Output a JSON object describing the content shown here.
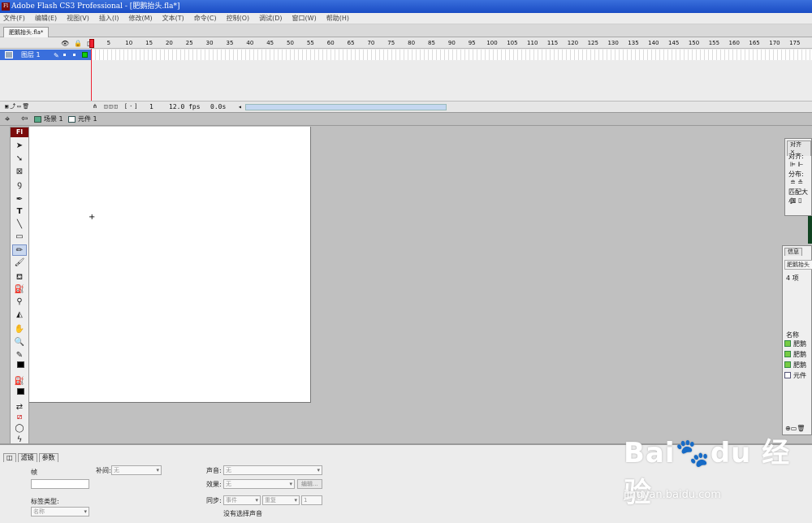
{
  "window": {
    "title": "Adobe Flash CS3 Professional - [肥鹅抬头.fla*]",
    "app_icon": "Fl"
  },
  "menu": [
    "文件(F)",
    "编辑(E)",
    "视图(V)",
    "插入(I)",
    "修改(M)",
    "文本(T)",
    "命令(C)",
    "控制(O)",
    "调试(D)",
    "窗口(W)",
    "帮助(H)"
  ],
  "document_tab": "肥鹅抬头.fla*",
  "timeline": {
    "layer_name": "图层 1",
    "ruler_ticks": [
      "1",
      "5",
      "10",
      "15",
      "20",
      "25",
      "30",
      "35",
      "40",
      "45",
      "50",
      "55",
      "60",
      "65",
      "70",
      "75",
      "80",
      "85",
      "90",
      "95",
      "100",
      "105",
      "110",
      "115",
      "120",
      "125",
      "130",
      "135",
      "140",
      "145",
      "150",
      "155",
      "160",
      "165",
      "170",
      "175"
    ],
    "current_frame": "1",
    "frame_rate": "12.0 fps",
    "elapsed": "0.0s"
  },
  "edit_bar": {
    "scene": "场景 1",
    "symbol": "元件 1"
  },
  "toolbar": {
    "logo": "Fl",
    "text_tool": "T"
  },
  "align_panel": {
    "tab": "对齐",
    "align": "对齐:",
    "distribute": "分布:",
    "match_size": "匹配大小"
  },
  "library_panel": {
    "tab": "信息",
    "doc": "肥鹅抬头",
    "count": "4 项",
    "name_header": "名称",
    "items": [
      "肥鹅",
      "肥鹅",
      "肥鹅",
      "元件"
    ]
  },
  "properties": {
    "tabs": [
      "滤镜",
      "参数"
    ],
    "frame_label": "帧",
    "tween_label": "补间:",
    "tween_value": "无",
    "sound_label": "声音:",
    "sound_value": "无",
    "effect_label": "效果:",
    "effect_value": "无",
    "edit_button": "编辑...",
    "sync_label": "同步:",
    "sync_value": "事件",
    "repeat_value": "重复",
    "repeat_count": "1",
    "label_type": "标签类型:",
    "label_type_value": "名称",
    "no_sound": "没有选择声音"
  },
  "watermark": {
    "logo": "Bai🐾du 经验",
    "url": "jingyan.baidu.com"
  }
}
